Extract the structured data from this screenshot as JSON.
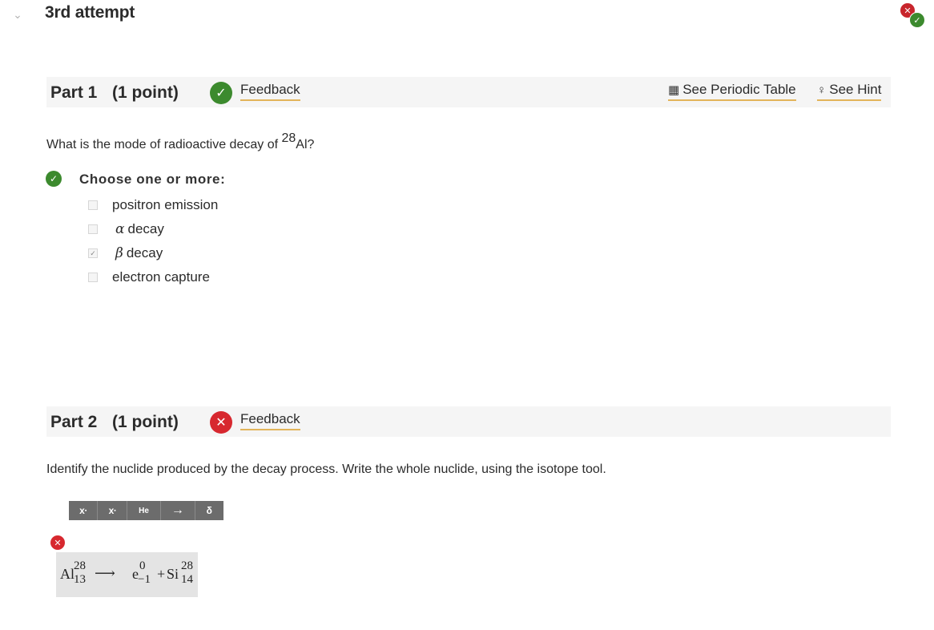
{
  "header": {
    "attempt_title": "3rd attempt",
    "chevron_icon": "chevron-down",
    "status_icons": [
      "x-icon",
      "check-icon"
    ]
  },
  "part1": {
    "title": "Part 1",
    "points": "(1 point)",
    "status": "correct",
    "feedback_label": "Feedback",
    "periodic_table_label": "See Periodic Table",
    "hint_label": "See Hint",
    "question_prefix": "What is the mode of radioactive decay of ",
    "question_mass": "28",
    "question_element": "Al?",
    "choose_label": "Choose one or more:",
    "options": [
      {
        "greek": "",
        "label": "positron emission",
        "checked": false
      },
      {
        "greek": "α",
        "label": "decay",
        "checked": false
      },
      {
        "greek": "β",
        "label": "decay",
        "checked": true
      },
      {
        "greek": "",
        "label": "electron capture",
        "checked": false
      }
    ]
  },
  "part2": {
    "title": "Part 2",
    "points": "(1 point)",
    "status": "incorrect",
    "feedback_label": "Feedback",
    "question": "Identify the nuclide produced by the decay process. Write the whole nuclide, using the isotope tool.",
    "toolbar": [
      "x",
      "x",
      "He",
      "→",
      "δ"
    ],
    "answer": {
      "reactant_symbol": "Al",
      "reactant_mass": "28",
      "reactant_z": "13",
      "arrow": "⟶",
      "p1_symbol": "e",
      "p1_mass": "0",
      "p1_z": "−1",
      "plus": "+",
      "p2_symbol": "Si",
      "p2_mass": "28",
      "p2_z": "14"
    }
  },
  "colors": {
    "correct": "#3c8a2e",
    "incorrect": "#d7282f",
    "link_underline": "#e2b45a"
  }
}
